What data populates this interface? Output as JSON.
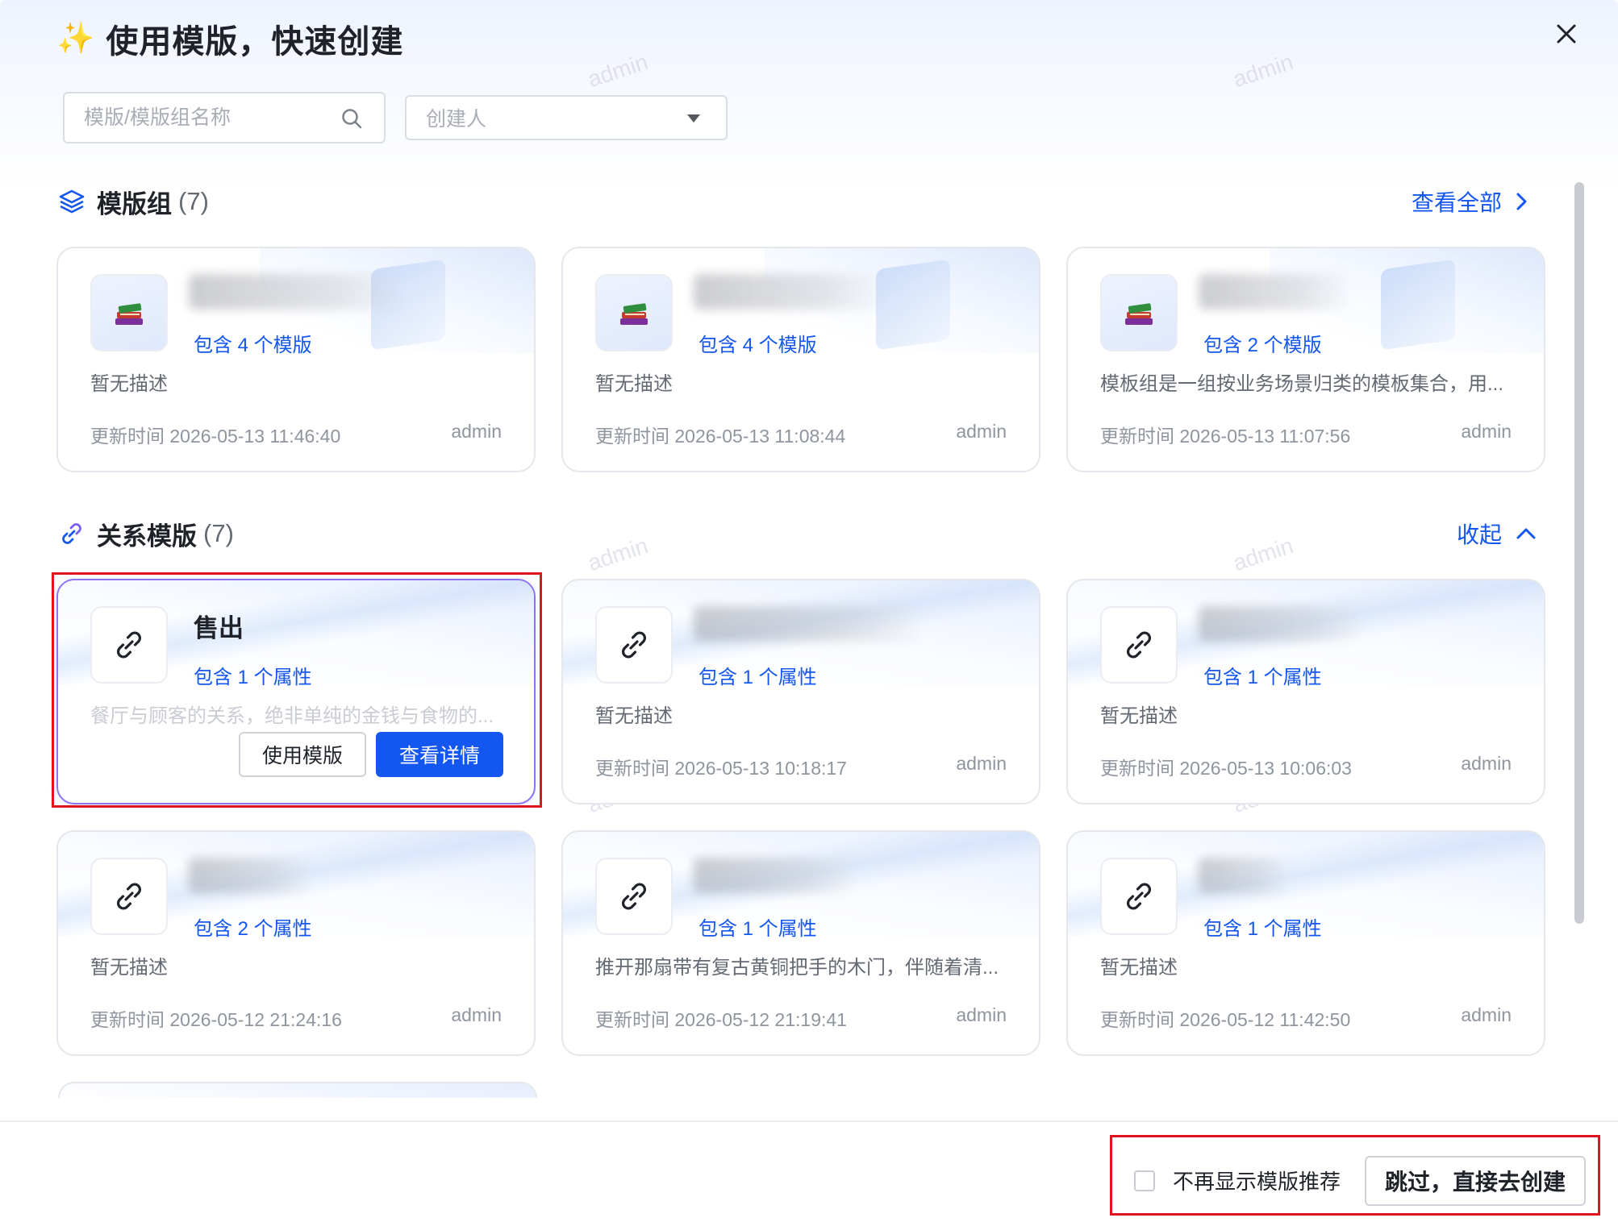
{
  "header": {
    "title": "使用模版，快速创建",
    "sparkle_icon": "sparkle-icon",
    "close_icon": "close-icon"
  },
  "filters": {
    "search_placeholder": "模版/模版组名称",
    "creator_placeholder": "创建人"
  },
  "watermark_text": "admin",
  "sections": {
    "groups": {
      "title": "模版组",
      "count": "(7)",
      "link_label": "查看全部",
      "icon": "layers-icon",
      "cards": [
        {
          "count": "包含 4 个模版",
          "desc": "暂无描述",
          "time": "更新时间 2026-05-13 11:46:40",
          "author": "admin"
        },
        {
          "count": "包含 4 个模版",
          "desc": "暂无描述",
          "time": "更新时间 2026-05-13 11:08:44",
          "author": "admin"
        },
        {
          "count": "包含 2 个模版",
          "desc": "模板组是一组按业务场景归类的模板集合，用...",
          "time": "更新时间 2026-05-13 11:07:56",
          "author": "admin"
        }
      ]
    },
    "relations": {
      "title": "关系模版",
      "count": "(7)",
      "link_label": "收起",
      "icon": "link-icon",
      "cards": [
        {
          "name": "售出",
          "count": "包含 1 个属性",
          "desc": "餐厅与顾客的关系，绝非单纯的金钱与食物的...",
          "use_label": "使用模版",
          "detail_label": "查看详情"
        },
        {
          "count": "包含 1 个属性",
          "desc": "暂无描述",
          "time": "更新时间 2026-05-13 10:18:17",
          "author": "admin"
        },
        {
          "count": "包含 1 个属性",
          "desc": "暂无描述",
          "time": "更新时间 2026-05-13 10:06:03",
          "author": "admin"
        },
        {
          "count": "包含 2 个属性",
          "desc": "暂无描述",
          "time": "更新时间 2026-05-12 21:24:16",
          "author": "admin"
        },
        {
          "count": "包含 1 个属性",
          "desc": "推开那扇带有复古黄铜把手的木门，伴随着清...",
          "time": "更新时间 2026-05-12 21:19:41",
          "author": "admin"
        },
        {
          "count": "包含 1 个属性",
          "desc": "暂无描述",
          "time": "更新时间 2026-05-12 11:42:50",
          "author": "admin"
        }
      ]
    }
  },
  "footer": {
    "checkbox_label": "不再显示模版推荐",
    "skip_label": "跳过，直接去创建"
  },
  "colors": {
    "accent": "#1456f0",
    "highlight": "#e0141e",
    "hover_border": "#8d73f0"
  }
}
